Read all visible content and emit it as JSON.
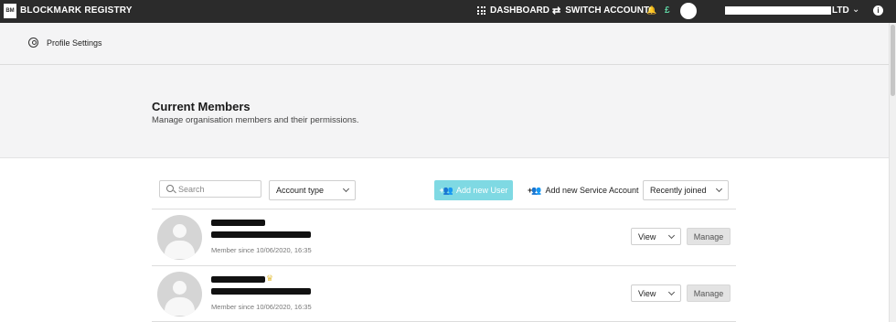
{
  "topbar": {
    "logo_text": "BM",
    "app_title": "BLOCKMARK REGISTRY",
    "dashboard_label": "DASHBOARD",
    "switch_label": "SWITCH ACCOUNT",
    "currency_symbol": "£",
    "company_suffix": "LTD",
    "icons": [
      "grid-icon",
      "switch-account-icon",
      "bell-icon",
      "avatar",
      "chevron-down-icon",
      "info-icon"
    ]
  },
  "subheader": {
    "profile_label": "Profile Settings"
  },
  "hero": {
    "title": "Current Members",
    "subtitle": "Manage organisation members and their permissions."
  },
  "toolbar": {
    "search_placeholder": "Search",
    "account_type_label": "Account type",
    "add_user_label": "Add new User",
    "add_service_label": "Add new Service Account",
    "sort_label": "Recently joined"
  },
  "members": [
    {
      "since": "Member since 10/06/2020, 16:35",
      "view_label": "View",
      "manage_label": "Manage",
      "owner": false
    },
    {
      "since": "Member since 10/06/2020, 16:35",
      "view_label": "View",
      "manage_label": "Manage",
      "owner": true
    }
  ],
  "colors": {
    "topbar": "#2b2b2b",
    "accent": "#7fd9e3",
    "currency": "#5fd3a3",
    "crown": "#e6c245"
  }
}
